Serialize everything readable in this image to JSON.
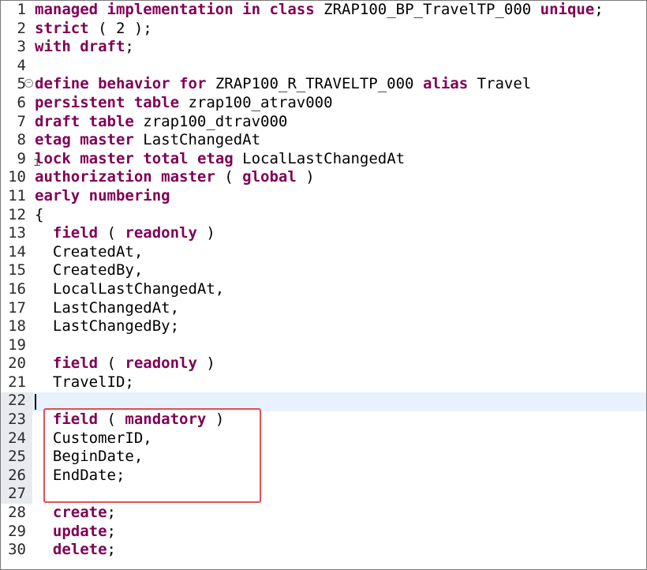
{
  "editor": {
    "lines": [
      {
        "n": "1",
        "tokens": [
          {
            "t": "managed",
            "k": 1
          },
          {
            "t": " "
          },
          {
            "t": "implementation",
            "k": 1
          },
          {
            "t": " "
          },
          {
            "t": "in",
            "k": 1
          },
          {
            "t": " "
          },
          {
            "t": "class",
            "k": 1
          },
          {
            "t": " ZRAP100_BP_TravelTP_000 "
          },
          {
            "t": "unique",
            "k": 1
          },
          {
            "t": ";"
          }
        ]
      },
      {
        "n": "2",
        "tokens": [
          {
            "t": "strict",
            "k": 1
          },
          {
            "t": " ( 2 );"
          }
        ]
      },
      {
        "n": "3",
        "tokens": [
          {
            "t": "with",
            "k": 1
          },
          {
            "t": " "
          },
          {
            "t": "draft",
            "k": 1
          },
          {
            "t": ";"
          }
        ]
      },
      {
        "n": "4",
        "tokens": []
      },
      {
        "n": "5",
        "fold": true,
        "tokens": [
          {
            "t": "define",
            "k": 1
          },
          {
            "t": " "
          },
          {
            "t": "behavior",
            "k": 1
          },
          {
            "t": " "
          },
          {
            "t": "for",
            "k": 1
          },
          {
            "t": " ZRAP100_R_TRAVELTP_000 "
          },
          {
            "t": "alias",
            "k": 1
          },
          {
            "t": " Travel"
          }
        ]
      },
      {
        "n": "6",
        "tokens": [
          {
            "t": "persistent",
            "k": 1
          },
          {
            "t": " "
          },
          {
            "t": "table",
            "k": 1
          },
          {
            "t": " zrap100_atrav000"
          }
        ]
      },
      {
        "n": "7",
        "tokens": [
          {
            "t": "draft",
            "k": 1
          },
          {
            "t": " "
          },
          {
            "t": "table",
            "k": 1
          },
          {
            "t": " zrap100_dtrav000"
          }
        ]
      },
      {
        "n": "8",
        "tokens": [
          {
            "t": "etag",
            "k": 1
          },
          {
            "t": " "
          },
          {
            "t": "master",
            "k": 1
          },
          {
            "t": " LastChangedAt"
          }
        ]
      },
      {
        "n": "9",
        "tokens": [
          {
            "t": "lock",
            "k": 1
          },
          {
            "t": " "
          },
          {
            "t": "master",
            "k": 1
          },
          {
            "t": " "
          },
          {
            "t": "total",
            "k": 1
          },
          {
            "t": " "
          },
          {
            "t": "etag",
            "k": 1
          },
          {
            "t": " LocalLastChangedAt"
          }
        ]
      },
      {
        "n": "10",
        "tokens": [
          {
            "t": "authorization",
            "k": 1
          },
          {
            "t": " "
          },
          {
            "t": "master",
            "k": 1
          },
          {
            "t": " ( "
          },
          {
            "t": "global",
            "k": 1
          },
          {
            "t": " )"
          }
        ]
      },
      {
        "n": "11",
        "tokens": [
          {
            "t": "early",
            "k": 1
          },
          {
            "t": " "
          },
          {
            "t": "numbering",
            "k": 1
          }
        ]
      },
      {
        "n": "12",
        "tokens": [
          {
            "t": "{"
          }
        ]
      },
      {
        "n": "13",
        "tokens": [
          {
            "t": "  "
          },
          {
            "t": "field",
            "k": 1
          },
          {
            "t": " ( "
          },
          {
            "t": "readonly",
            "k": 1
          },
          {
            "t": " )"
          }
        ]
      },
      {
        "n": "14",
        "tokens": [
          {
            "t": "  CreatedAt,"
          }
        ]
      },
      {
        "n": "15",
        "tokens": [
          {
            "t": "  CreatedBy,"
          }
        ]
      },
      {
        "n": "16",
        "tokens": [
          {
            "t": "  LocalLastChangedAt,"
          }
        ]
      },
      {
        "n": "17",
        "tokens": [
          {
            "t": "  LastChangedAt,"
          }
        ]
      },
      {
        "n": "18",
        "tokens": [
          {
            "t": "  LastChangedBy;"
          }
        ]
      },
      {
        "n": "19",
        "tokens": []
      },
      {
        "n": "20",
        "tokens": [
          {
            "t": "  "
          },
          {
            "t": "field",
            "k": 1
          },
          {
            "t": " ( "
          },
          {
            "t": "readonly",
            "k": 1
          },
          {
            "t": " )"
          }
        ]
      },
      {
        "n": "21",
        "tokens": [
          {
            "t": "  TravelID;"
          }
        ]
      },
      {
        "n": "22",
        "tokens": []
      },
      {
        "n": "23",
        "tokens": [
          {
            "t": "  "
          },
          {
            "t": "field",
            "k": 1
          },
          {
            "t": " ( "
          },
          {
            "t": "mandatory",
            "k": 1
          },
          {
            "t": " )"
          }
        ]
      },
      {
        "n": "24",
        "tokens": [
          {
            "t": "  CustomerID,"
          }
        ]
      },
      {
        "n": "25",
        "tokens": [
          {
            "t": "  BeginDate,"
          }
        ]
      },
      {
        "n": "26",
        "tokens": [
          {
            "t": "  EndDate;"
          }
        ]
      },
      {
        "n": "27",
        "tokens": []
      },
      {
        "n": "28",
        "tokens": [
          {
            "t": "  "
          },
          {
            "t": "create",
            "k": 1
          },
          {
            "t": ";"
          }
        ]
      },
      {
        "n": "29",
        "tokens": [
          {
            "t": "  "
          },
          {
            "t": "update",
            "k": 1
          },
          {
            "t": ";"
          }
        ]
      },
      {
        "n": "30",
        "tokens": [
          {
            "t": "  "
          },
          {
            "t": "delete",
            "k": 1
          },
          {
            "t": ";"
          }
        ]
      }
    ],
    "changed_line_band": {
      "from": "22",
      "to": "27"
    },
    "current_line": "22",
    "highlighted_block": {
      "from": "23",
      "to": "27"
    },
    "fold_icon": "collapse-minus-icon",
    "colors": {
      "keyword": "#7f0055",
      "text": "#000000",
      "highlight_border": "#e05252",
      "current_line_bg": "#e8f2fe",
      "gutter_band_bg": "#e8eaef"
    }
  }
}
